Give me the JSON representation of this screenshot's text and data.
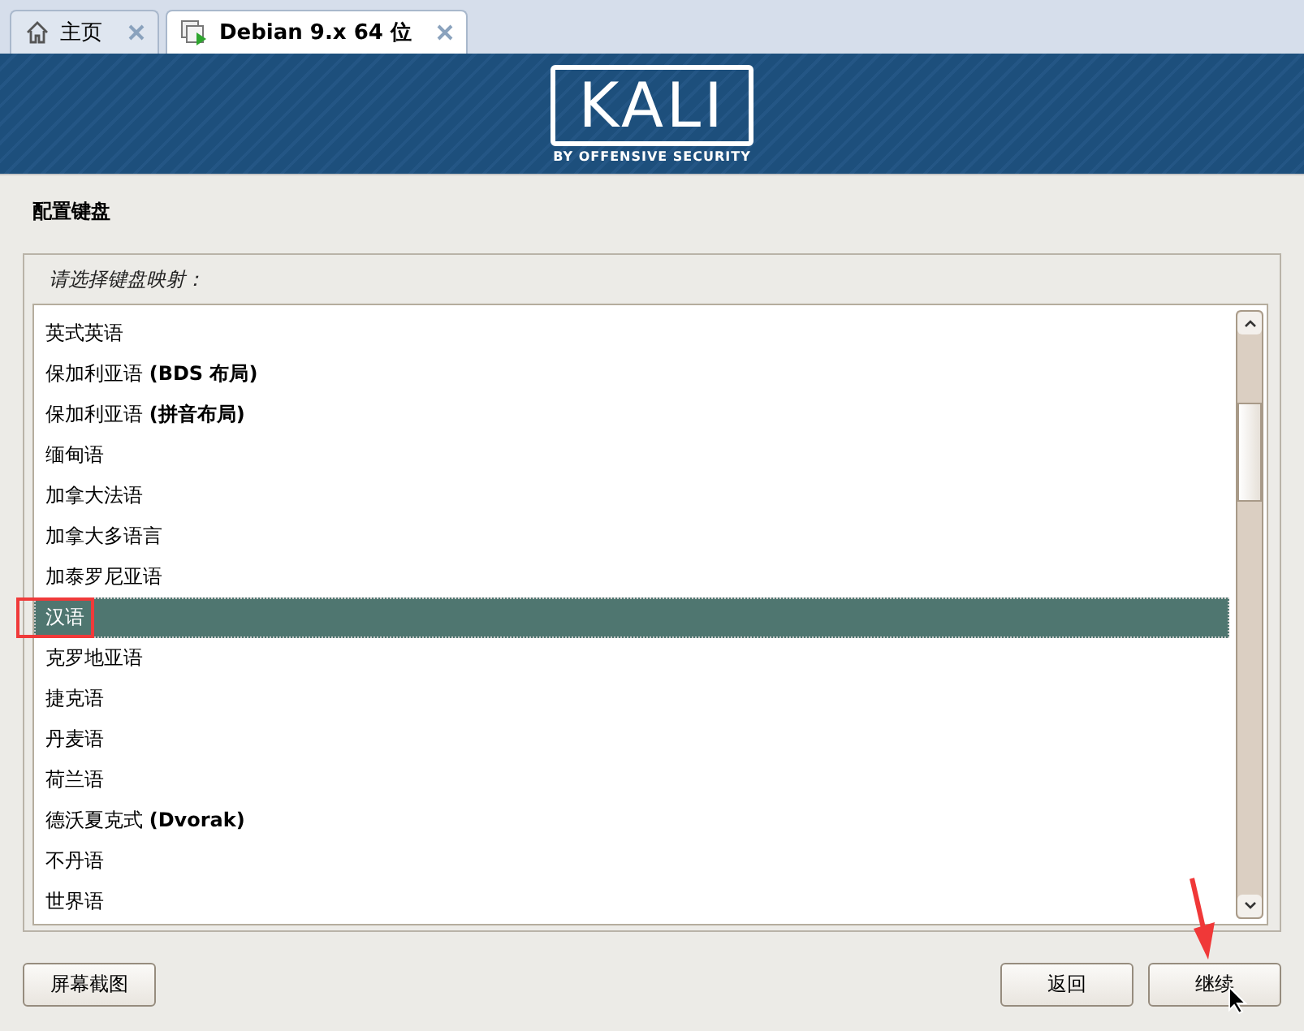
{
  "tabs": [
    {
      "label": "主页",
      "kind": "home",
      "selected": false
    },
    {
      "label": "Debian 9.x 64 位",
      "kind": "machine",
      "selected": true
    }
  ],
  "banner": {
    "logo": "KALI",
    "tagline": "BY OFFENSIVE SECURITY"
  },
  "page_title": "配置键盘",
  "prompt": "请选择键盘映射：",
  "keymaps": [
    {
      "label": "英式英语",
      "selected": false,
      "highlighted": false
    },
    {
      "label": "保加利亚语 **(BDS 布局)**",
      "selected": false,
      "highlighted": false
    },
    {
      "label": "保加利亚语 **(拼音布局)**",
      "selected": false,
      "highlighted": false
    },
    {
      "label": "缅甸语",
      "selected": false,
      "highlighted": false
    },
    {
      "label": "加拿大法语",
      "selected": false,
      "highlighted": false
    },
    {
      "label": "加拿大多语言",
      "selected": false,
      "highlighted": false
    },
    {
      "label": "加泰罗尼亚语",
      "selected": false,
      "highlighted": false
    },
    {
      "label": "汉语",
      "selected": true,
      "highlighted": true
    },
    {
      "label": "克罗地亚语",
      "selected": false,
      "highlighted": false
    },
    {
      "label": "捷克语",
      "selected": false,
      "highlighted": false
    },
    {
      "label": "丹麦语",
      "selected": false,
      "highlighted": false
    },
    {
      "label": "荷兰语",
      "selected": false,
      "highlighted": false
    },
    {
      "label": "德沃夏克式 **(Dvorak)**",
      "selected": false,
      "highlighted": false
    },
    {
      "label": "不丹语",
      "selected": false,
      "highlighted": false
    },
    {
      "label": "世界语",
      "selected": false,
      "highlighted": false
    }
  ],
  "buttons": {
    "left": [
      "屏幕截图"
    ],
    "right": [
      "返回",
      "继续"
    ]
  },
  "annotation_arrow": true
}
